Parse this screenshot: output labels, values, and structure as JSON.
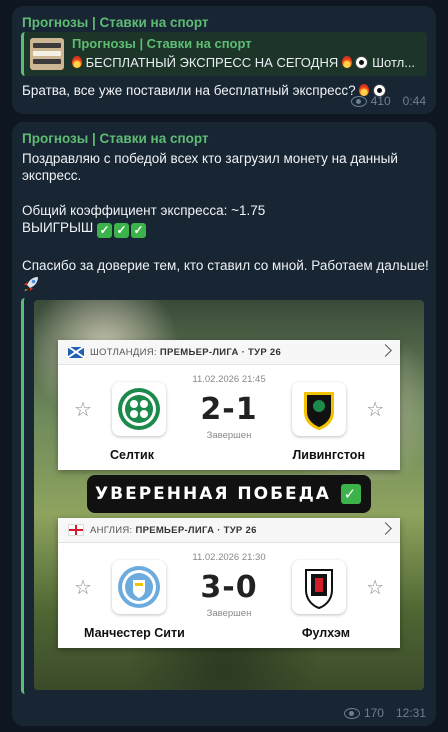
{
  "msg1": {
    "sender": "Прогнозы | Ставки на спорт",
    "reply": {
      "name": "Прогнозы | Ставки на спорт",
      "text": "БЕСПЛАТНЫЙ ЭКСПРЕСС НА СЕГОДНЯ",
      "suffix": "Шотл..."
    },
    "body": "Братва, все уже поставили на бесплатный экспресс?",
    "views": "410",
    "time": "0:44"
  },
  "msg2": {
    "sender": "Прогнозы | Ставки на спорт",
    "line1": "Поздравляю с победой всех кто загрузил монету на данный экспресс.",
    "line2": "Общий коэффициент экспресса: ~1.75",
    "line3": "ВЫИГРЫШ",
    "line4": "Спасибо за доверие тем, кто ставил со мной. Работаем дальше!",
    "views": "170",
    "time": "12:31"
  },
  "image": {
    "banner": "УВЕРЕННАЯ ПОБЕДА",
    "match1": {
      "country": "ШОТЛАНДИЯ:",
      "league": "ПРЕМЬЕР-ЛИГА · ТУР 26",
      "date": "11.02.2026 21:45",
      "score": "2-1",
      "status": "Завершен",
      "home": "Селтик",
      "away": "Ливингстон"
    },
    "match2": {
      "country": "АНГЛИЯ:",
      "league": "ПРЕМЬЕР-ЛИГА · ТУР 26",
      "date": "11.02.2026 21:30",
      "score": "3-0",
      "status": "Завершен",
      "home": "Манчестер Сити",
      "away": "Фулхэм"
    }
  },
  "colors": {
    "background": "#0e1621",
    "bubble": "#182533",
    "accent": "#5fbc75",
    "meta": "#6c7f92"
  }
}
